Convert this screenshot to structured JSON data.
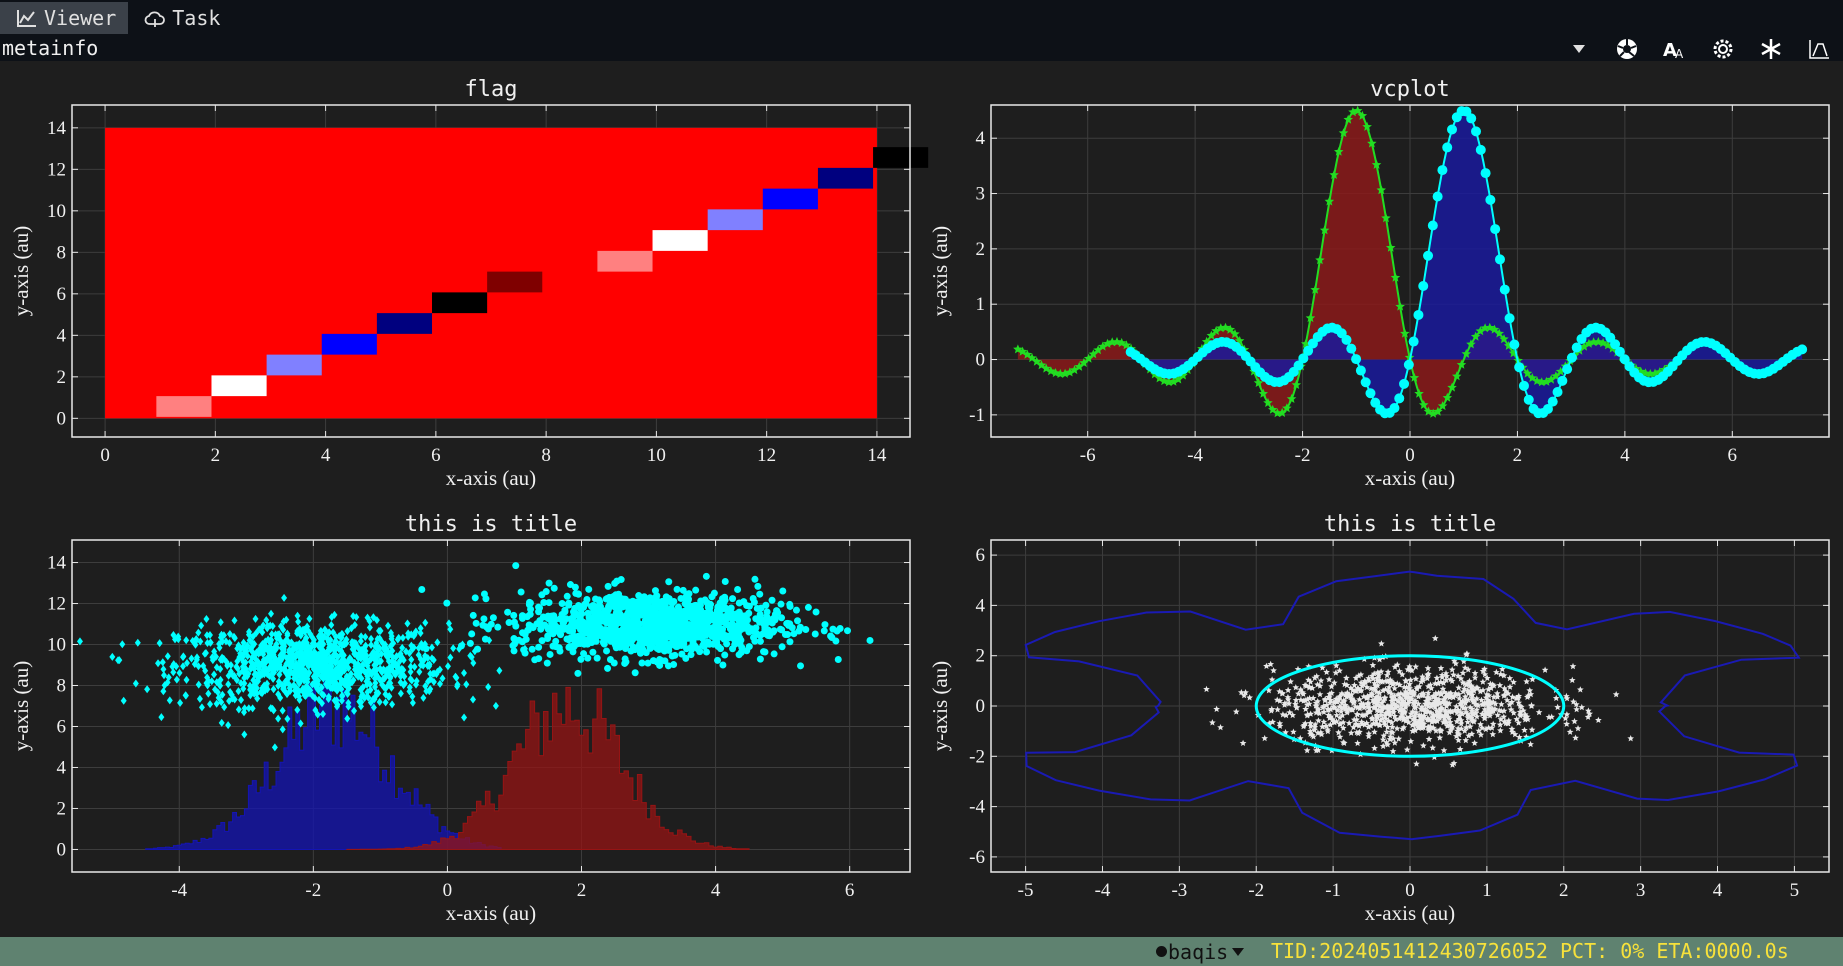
{
  "tabs": [
    {
      "label": "Viewer",
      "icon": "line-chart-icon",
      "active": true
    },
    {
      "label": "Task",
      "icon": "cloud-icon",
      "active": false
    }
  ],
  "metainfo_label": "metainfo",
  "toolbar_icons": [
    "dropdown-arrow-icon",
    "aperture-icon",
    "font-size-icon",
    "settings-gear-icon",
    "snowflake-icon",
    "chart-mode-icon"
  ],
  "status": {
    "user": "baqis",
    "tid_text": "TID:20240514124307260​52 PCT: 0% ETA:0000.0s",
    "user_dot_color": "#111111",
    "text_color": "#f7e13b"
  },
  "chart_data": [
    {
      "type": "heatmap",
      "title": "flag",
      "xlabel": "x-axis (au)",
      "ylabel": "y-axis (au)",
      "xlim": [
        -0.6,
        14.6
      ],
      "ylim": [
        -0.9,
        15.1
      ],
      "xticks": [
        0,
        2,
        4,
        6,
        8,
        10,
        12,
        14
      ],
      "yticks": [
        0,
        2,
        4,
        6,
        8,
        10,
        12,
        14
      ],
      "extent": [
        0,
        14,
        0,
        14
      ],
      "background_color": "#ff0000",
      "cells": [
        {
          "x": 1,
          "y": 1,
          "color": "#ff8080"
        },
        {
          "x": 2,
          "y": 2,
          "color": "#ffffff"
        },
        {
          "x": 3,
          "y": 3,
          "color": "#8080ff"
        },
        {
          "x": 4,
          "y": 4,
          "color": "#0000ff"
        },
        {
          "x": 5,
          "y": 5,
          "color": "#00007f"
        },
        {
          "x": 6,
          "y": 6,
          "color": "#000000"
        },
        {
          "x": 7,
          "y": 7,
          "color": "#7f0000"
        },
        {
          "x": 9,
          "y": 8,
          "color": "#ff8080"
        },
        {
          "x": 10,
          "y": 9,
          "color": "#ffffff"
        },
        {
          "x": 11,
          "y": 10,
          "color": "#8080ff"
        },
        {
          "x": 12,
          "y": 11,
          "color": "#0000ff"
        },
        {
          "x": 13,
          "y": 12,
          "color": "#00007f"
        },
        {
          "x": 14,
          "y": 13,
          "color": "#000000"
        }
      ]
    },
    {
      "type": "line",
      "title": "vcplot",
      "xlabel": "x-axis (au)",
      "ylabel": "y-axis (au)",
      "xlim": [
        -7.8,
        7.8
      ],
      "ylim": [
        -1.4,
        4.6
      ],
      "xticks": [
        -6,
        -4,
        -2,
        0,
        2,
        4,
        6
      ],
      "yticks": [
        -1,
        0,
        1,
        2,
        3,
        4
      ],
      "series": [
        {
          "function": "4.5*sin(pi*(x+1))/(pi*(x+1))",
          "x_range": [
            -7.3,
            5.0
          ],
          "marker": "star",
          "color": "#22dd22",
          "fill_color": "#8b1a1a"
        },
        {
          "function": "4.5*sin(pi*(x-1))/(pi*(x-1))",
          "x_range": [
            -5.2,
            7.3
          ],
          "marker": "circle",
          "color": "#00ffff",
          "fill_color": "#1a1a9c"
        }
      ]
    },
    {
      "type": "scatter",
      "title": "this is title",
      "xlabel": "x-axis (au)",
      "ylabel": "y-axis (au)",
      "xlim": [
        -5.6,
        6.9
      ],
      "ylim": [
        -1.1,
        15.1
      ],
      "xticks": [
        -4,
        -2,
        0,
        2,
        4,
        6
      ],
      "yticks": [
        0,
        2,
        4,
        6,
        8,
        10,
        12,
        14
      ],
      "scatter": [
        {
          "name": "diamonds",
          "center": [
            -2,
            9
          ],
          "spread": [
            1,
            1
          ],
          "marker": "diamond",
          "color": "#00ffff"
        },
        {
          "name": "circles",
          "center": [
            3,
            11
          ],
          "spread": [
            1,
            0.8
          ],
          "marker": "circle",
          "color": "#00ffff"
        }
      ],
      "histograms": [
        {
          "center": -1.7,
          "spread": 0.85,
          "range": [
            -4.5,
            0.8
          ],
          "peak": 7,
          "color": "#1414b4"
        },
        {
          "center": 1.8,
          "spread": 0.8,
          "range": [
            -1.5,
            4.5
          ],
          "peak": 7,
          "color": "#961414"
        }
      ]
    },
    {
      "type": "scatter",
      "title": "this is title",
      "xlabel": "x-axis (au)",
      "ylabel": "y-axis (au)",
      "xlim": [
        -5.45,
        5.45
      ],
      "ylim": [
        -6.6,
        6.6
      ],
      "xticks": [
        -5,
        -4,
        -3,
        -2,
        -1,
        0,
        1,
        2,
        3,
        4,
        5
      ],
      "yticks": [
        -6,
        -4,
        -2,
        0,
        2,
        4,
        6
      ],
      "scatter": [
        {
          "name": "stars",
          "center": [
            0,
            0
          ],
          "spread": [
            0.9,
            0.75
          ],
          "marker": "star",
          "color": "#e8e8e8"
        }
      ],
      "ellipse": {
        "center": [
          0,
          0
        ],
        "rx": 2,
        "ry": 2,
        "color": "#00ffff"
      },
      "contour": {
        "color": "#1a1ab4",
        "outer_half_width": 5,
        "outer_half_height": 5.2
      }
    }
  ]
}
